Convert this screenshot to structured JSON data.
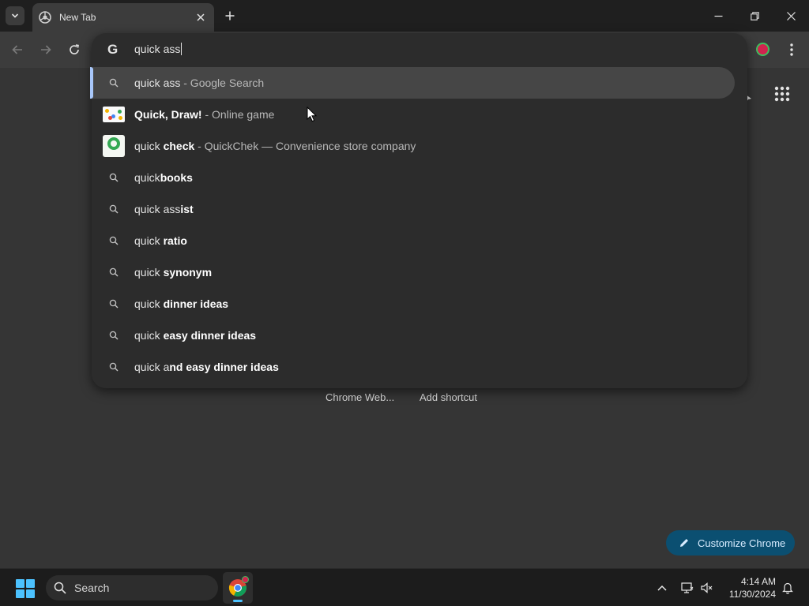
{
  "tab": {
    "title": "New Tab"
  },
  "omnibox": {
    "query": "quick ass",
    "suggestions": [
      {
        "type": "search",
        "typed": "quick ass",
        "bold": "",
        "desc": " - Google Search",
        "selected": true
      },
      {
        "type": "entity-draw",
        "typed": "",
        "bold": "Quick, Draw!",
        "desc": " - Online game"
      },
      {
        "type": "entity-qc",
        "typed": "quick ",
        "bold": "check",
        "desc": " - QuickChek — Convenience store company"
      },
      {
        "type": "search",
        "typed": "quick",
        "bold": "books",
        "desc": ""
      },
      {
        "type": "search",
        "typed": "quick ass",
        "bold": "ist",
        "desc": ""
      },
      {
        "type": "search",
        "typed": "quick ",
        "bold": "ratio",
        "desc": ""
      },
      {
        "type": "search",
        "typed": "quick ",
        "bold": "synonym",
        "desc": ""
      },
      {
        "type": "search",
        "typed": "quick ",
        "bold": "dinner ideas",
        "desc": ""
      },
      {
        "type": "search",
        "typed": "quick ",
        "bold": "easy dinner ideas",
        "desc": ""
      },
      {
        "type": "search",
        "typed": "quick a",
        "bold": "nd easy dinner ideas",
        "desc": ""
      }
    ]
  },
  "page": {
    "shortcuts": [
      "Chrome Web...",
      "Add shortcut"
    ],
    "customize_label": "Customize Chrome"
  },
  "taskbar": {
    "search_label": "Search",
    "time": "4:14 AM",
    "date": "11/30/2024"
  },
  "colors": {
    "accent": "#a8c7fa",
    "customize_bg": "#0b4f71",
    "start_icon": "#4cc2ff"
  }
}
